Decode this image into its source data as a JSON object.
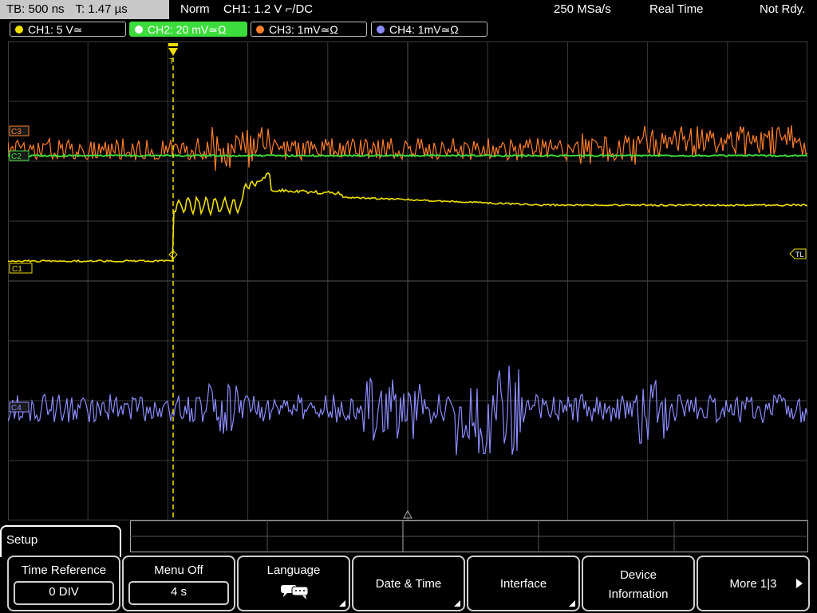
{
  "topbar": {
    "timebase": "TB: 500 ns",
    "trigger_time": "T: 1.47 µs",
    "trigger_mode": "Norm",
    "trigger_info": "CH1: 1.2 V ⌐/DC",
    "sample_rate": "250 MSa/s",
    "acq_mode": "Real Time",
    "status": "Not Rdy."
  },
  "channels": [
    {
      "label": "CH1: 5 V≃",
      "color": "#f0e000",
      "active": false
    },
    {
      "label": "CH2: 20 mV≃Ω",
      "color": "#3cdc3c",
      "active": true
    },
    {
      "label": "CH3: 1mV≃Ω",
      "color": "#ff7f2a",
      "active": false
    },
    {
      "label": "CH4: 1mV≃Ω",
      "color": "#8c8cff",
      "active": false
    }
  ],
  "markers": {
    "c1": "C1",
    "c2": "C2",
    "c3": "C3",
    "c4": "C4",
    "tl": "TL",
    "trigger": "T"
  },
  "menu": {
    "title": "Setup",
    "softkeys": [
      {
        "label": "Time Reference",
        "value": "0 DIV"
      },
      {
        "label": "Menu Off",
        "value": "4 s"
      },
      {
        "label": "Language",
        "icon": "speech-bubble-icon"
      },
      {
        "label": "Date & Time"
      },
      {
        "label": "Interface"
      },
      {
        "label_line1": "Device",
        "label_line2": "Information"
      },
      {
        "label": "More 1|3"
      }
    ]
  },
  "colors": {
    "ch1": "#f0e000",
    "ch2": "#3cdc3c",
    "ch3": "#ff7f2a",
    "ch4": "#8c8cff",
    "grid": "#3a3a3a"
  }
}
